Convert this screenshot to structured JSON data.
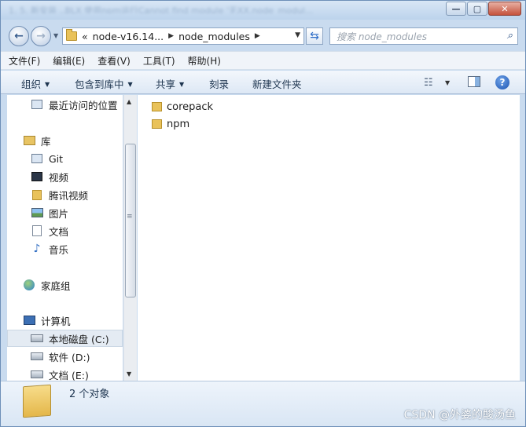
{
  "window": {
    "title_blurred": "1. 5. 新安装 ..BLX 使用npm运行Cannot find module '无XX.node_modul..."
  },
  "address": {
    "crumb_overflow": "«",
    "crumbs": [
      "node-v16.14...",
      "node_modules"
    ],
    "search_placeholder": "搜索 node_modules"
  },
  "menu": [
    "文件(F)",
    "编辑(E)",
    "查看(V)",
    "工具(T)",
    "帮助(H)"
  ],
  "toolbar": {
    "organize": "组织",
    "include_in_library": "包含到库中",
    "share": "共享",
    "burn": "刻录",
    "new_folder": "新建文件夹"
  },
  "nav": {
    "recent": "最近访问的位置",
    "libraries": "库",
    "lib_items": [
      "Git",
      "视频",
      "腾讯视频",
      "图片",
      "文档",
      "音乐"
    ],
    "homegroup": "家庭组",
    "computer": "计算机",
    "drives": [
      "本地磁盘 (C:)",
      "软件 (D:)",
      "文档 (E:)"
    ]
  },
  "files": [
    "corepack",
    "npm"
  ],
  "status": {
    "count": "2 个对象"
  },
  "watermark": "CSDN @外婆的酸汤鱼"
}
